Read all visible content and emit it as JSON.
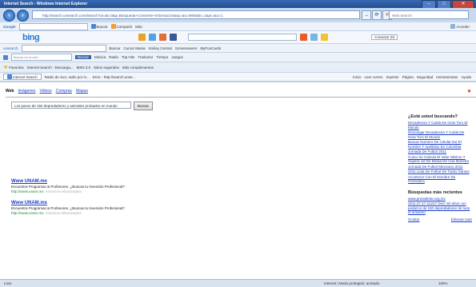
{
  "window": {
    "title": "Internet Search - Windows Internet Explorer",
    "minimize": "–",
    "maximize": "□",
    "close": "✕"
  },
  "address": {
    "url": "http://search.unsearch.com/Search?ai=&t=0&q=Búsqueda+Convierte+Información&sp=&s=Web&bc=1&pr=&ui=1",
    "search_placeholder": "Web Search",
    "go_icon": "→",
    "refresh_icon": "⟳",
    "stop_icon": "✕"
  },
  "toolbar1": {
    "google": "Google",
    "search": "Buscar",
    "share": "Compartir",
    "more": "Más",
    "signin": "Acceder"
  },
  "toolbar2": {
    "bing": "bing",
    "connect": "Conectar (0)"
  },
  "toolbar3": {
    "unsearch": "unsearch",
    "items": [
      "Buscar",
      "Cursor Mania",
      "Smiley Central",
      "Screensavers",
      "MyFunCards"
    ]
  },
  "toolbar4": {
    "search_placeholder": "Buscar en la web",
    "search": "Buscar",
    "items": [
      "Música",
      "Radio",
      "Top Hits",
      "Traductor",
      "Tiempo",
      "Juegos"
    ]
  },
  "toolbar5": {
    "favorites": "Favoritos",
    "items": [
      "Internet Search - Descarga...",
      "MSN 3.0",
      "Sitios sugeridos",
      "Más complementos"
    ]
  },
  "toolbar6": {
    "tab": "Internet Search",
    "items": [
      "Radio de vivo, radio por in...",
      "Error - http://search.unse..."
    ],
    "right": [
      "Inicio",
      "Leer correo",
      "Imprimir",
      "Página",
      "Seguridad",
      "Herramientas",
      "Ayuda"
    ]
  },
  "page": {
    "tabs": {
      "web": "Web",
      "images": "Imágenes",
      "videos": "Videos",
      "shopping": "Compras",
      "maps": "Mapas"
    },
    "query": "Los pasos de 150 depredadores y animales probados en mundo",
    "search_button": "Buscar",
    "results": [
      {
        "title": "Www UNAM.mx",
        "snippet": "Encuentra Programas & Profesores. ¿Buscas tu Inversión Profesional?",
        "url": "http://www.unam.mx",
        "meta": "Anuncios relacionados"
      },
      {
        "title": "Www UNAM.mx",
        "snippet": "Encuentra Programas & Profesores. ¿Buscas tu Inversión Profesional?",
        "url": "http://www.unam.mx",
        "meta": "Anuncios relacionados"
      }
    ],
    "sidebar": {
      "heading": "¿Está usted buscando?",
      "links": [
        "Decadencia Y Caída De Gran Toro El Mundo",
        "Descargar Decadencia Y Caída De Gran Toro El Mundo",
        "Buscar Numero De Celular Ext El Nombre Y Apellidos En Colombia",
        "Jornada De Futbol 2011",
        "Como Se Calcula El Valor Minimo Y Supera Ud De Media De Una Muestra",
        "Jornada De Futbol Mexicano 2011",
        "2011 Lista De Futbol De Todos Santos",
        "Acontecer Con El Nombre De Gramatica"
      ],
      "recent_heading": "Búsquedas más recientes",
      "recent": [
        "www.presidente.org.mx",
        "2011.07.27.51227 Diez mil años con pedazos de 150 depredadores de todo el universo"
      ],
      "clear": "Ocultar",
      "delete": "Eliminar todo"
    }
  },
  "status": {
    "left": "Listo",
    "zone": "Internet | Modo protegido: activado",
    "zoom": "100%"
  },
  "colors": {
    "accent": "#2a7bd6",
    "link": "#1a3ec4",
    "url_green": "#1e8a2e",
    "titlebar": "#23508f"
  }
}
